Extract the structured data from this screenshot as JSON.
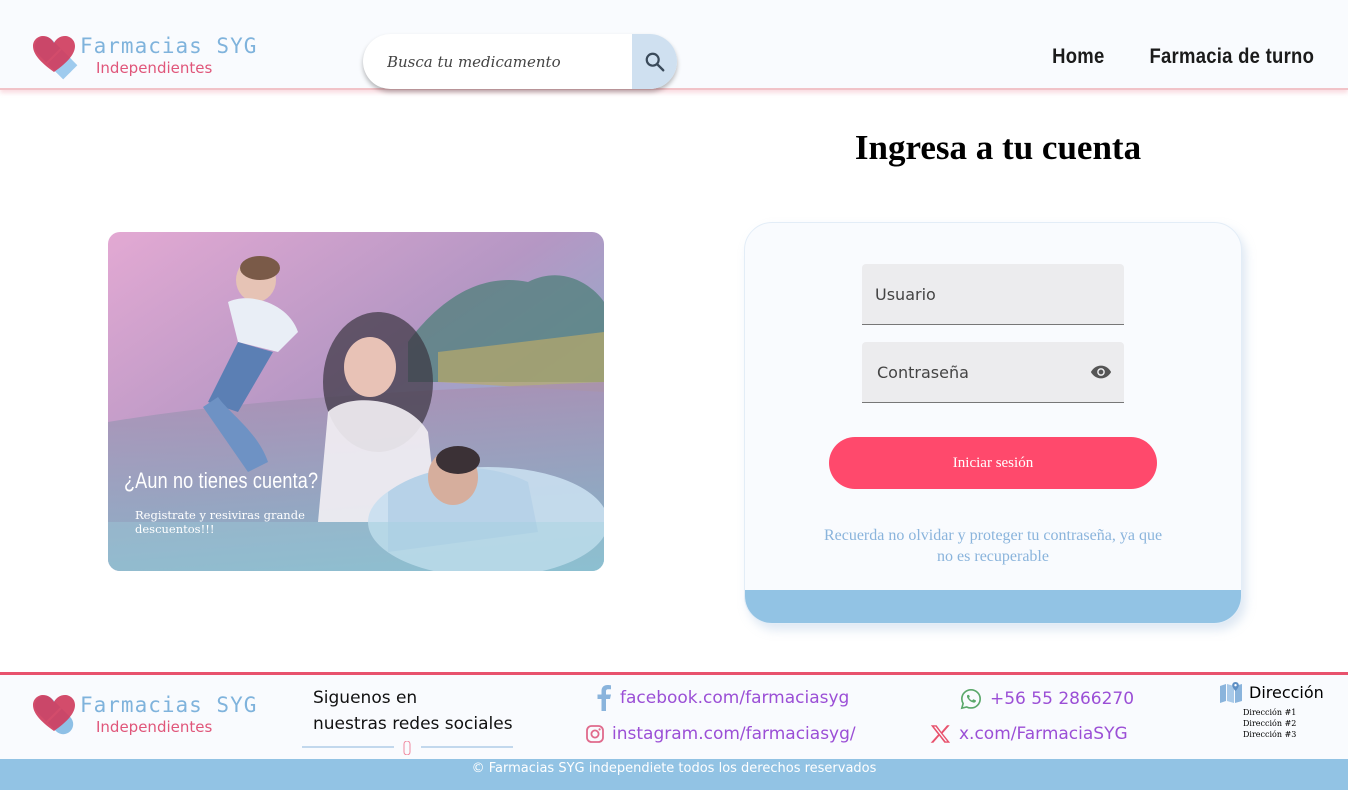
{
  "header": {
    "logo": {
      "brand": "Farmacias SYG",
      "sub": "Independientes"
    },
    "search": {
      "placeholder": "Busca tu medicamento",
      "icon": "search-icon"
    },
    "nav": [
      {
        "label": "Home"
      },
      {
        "label": "Farmacia de turno"
      }
    ]
  },
  "promo": {
    "title": "¿Aun no tienes cuenta?",
    "text": "Registrate y resiviras grande descuentos!!!"
  },
  "login": {
    "title": "Ingresa a tu cuenta",
    "username_placeholder": "Usuario",
    "password_placeholder": "Contraseña",
    "submit_label": "Iniciar sesión",
    "note": "Recuerda no olvidar y proteger tu contraseña, ya que no es recuperable"
  },
  "footer": {
    "logo": {
      "brand": "Farmacias SYG",
      "sub": "Independientes"
    },
    "follow_line1": "Siguenos en",
    "follow_line2": "nuestras redes sociales",
    "social": {
      "facebook": "facebook.com/farmaciasyg",
      "instagram": "instagram.com/farmaciasyg/",
      "whatsapp": "+56 55 2866270",
      "x": "x.com/FarmaciaSYG"
    },
    "address": {
      "title": "Dirección",
      "items": [
        "Dirección #1",
        "Dirección #2",
        "Dirección #3"
      ]
    },
    "copyright": "© Farmacias SYG independiete todos los derechos reservados"
  },
  "colors": {
    "accent": "#ff496c",
    "brand_blue": "#7fb3dc",
    "brand_pink": "#e0567a",
    "footer_bar": "#92c3e4",
    "social_text": "#9b4fd6"
  }
}
